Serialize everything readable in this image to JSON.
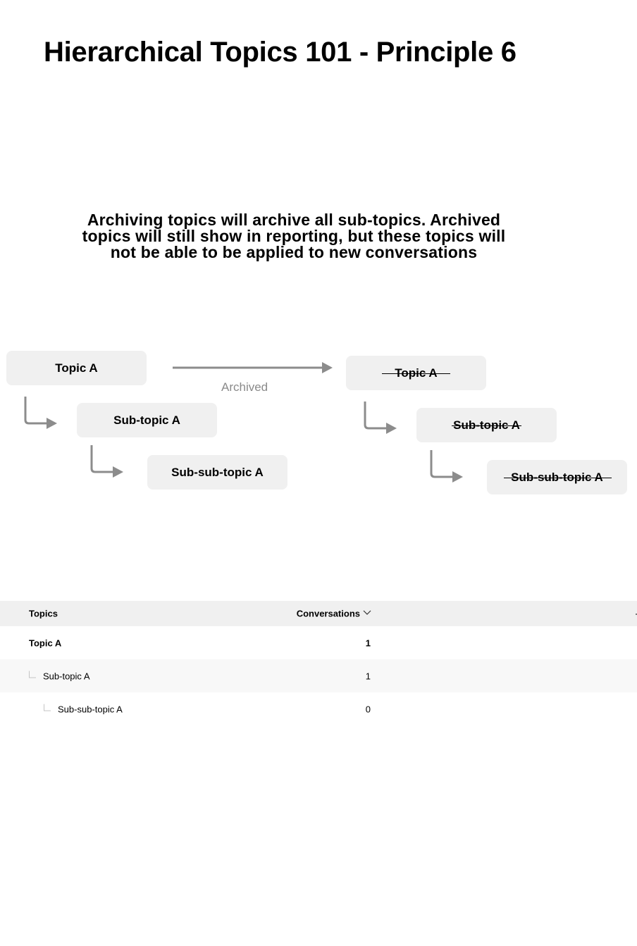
{
  "title": "Hierarchical Topics 101 - Principle 6",
  "description": "Archiving topics will archive all sub-topics. Archived topics will still show in reporting, but these topics will not be able to be applied to new conversations",
  "diagram": {
    "before": {
      "nodes": [
        "Topic A",
        "Sub-topic A",
        "Sub-sub-topic A"
      ]
    },
    "transition_label": "Archived",
    "after": {
      "nodes": [
        "Topic A",
        "Sub-topic A",
        "Sub-sub-topic A"
      ],
      "state": "archived (strikethrough)"
    },
    "colors": {
      "node_bg": "#f0f0f0",
      "arrow": "#8c8c8c",
      "label": "#8a8a8a"
    }
  },
  "table": {
    "headers": {
      "topics": "Topics",
      "conversations": "Conversations"
    },
    "sort_icon": "chevron-down-icon",
    "rows": [
      {
        "topic": "Topic A",
        "conversations": "1",
        "level": 0
      },
      {
        "topic": "Sub-topic A",
        "conversations": "1",
        "level": 1
      },
      {
        "topic": "Sub-sub-topic A",
        "conversations": "0",
        "level": 2
      }
    ]
  }
}
